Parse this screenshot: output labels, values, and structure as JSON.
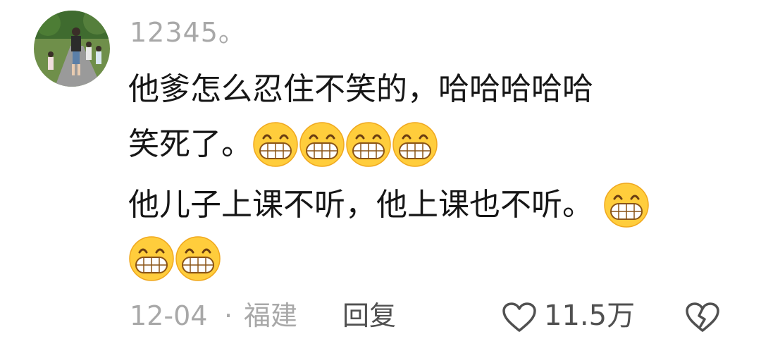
{
  "comment": {
    "username": "12345。",
    "text_line1": "他爹怎么忍住不笑的，哈哈哈哈哈",
    "text_line2": "笑死了。",
    "text_line3": "他儿子上课不听，他上课也不听。",
    "emoji_name": "grinning-face-icon",
    "date": "12-04",
    "separator": "·",
    "location": "福建",
    "reply_label": "回复",
    "like_count": "11.5万"
  },
  "colors": {
    "meta": "#a8a8a8",
    "text": "#161616",
    "action": "#505050",
    "emoji_face": "#ffcd3c"
  }
}
